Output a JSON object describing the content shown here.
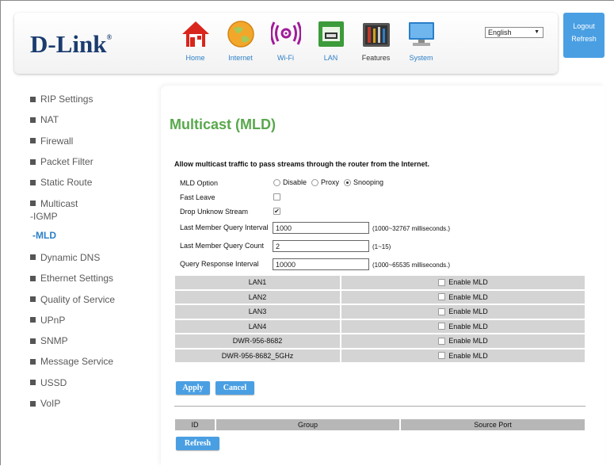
{
  "brand": {
    "logo_text": "D-Link",
    "logo_mark": "®"
  },
  "nav": [
    {
      "label": "Home",
      "icon": "home-icon"
    },
    {
      "label": "Internet",
      "icon": "globe-icon"
    },
    {
      "label": "Wi-Fi",
      "icon": "wifi-icon"
    },
    {
      "label": "LAN",
      "icon": "lan-icon"
    },
    {
      "label": "Features",
      "icon": "toolbox-icon"
    },
    {
      "label": "System",
      "icon": "monitor-icon"
    }
  ],
  "language": {
    "selected": "English"
  },
  "top_right": {
    "logout": "Logout",
    "refresh": "Refresh"
  },
  "sidebar": {
    "items": [
      {
        "label": "RIP Settings"
      },
      {
        "label": "NAT"
      },
      {
        "label": "Firewall"
      },
      {
        "label": "Packet Filter"
      },
      {
        "label": "Static Route"
      },
      {
        "label": "Multicast"
      }
    ],
    "sub_items": [
      {
        "label": "-IGMP"
      },
      {
        "label": "-MLD"
      }
    ],
    "items_after": [
      {
        "label": "Dynamic DNS"
      },
      {
        "label": "Ethernet Settings"
      },
      {
        "label": "Quality of Service"
      },
      {
        "label": "UPnP"
      },
      {
        "label": "SNMP"
      },
      {
        "label": "Message Service"
      },
      {
        "label": "USSD"
      },
      {
        "label": "VoIP"
      }
    ]
  },
  "main": {
    "title": "Multicast (MLD)",
    "description": "Allow multicast traffic to pass streams through the router from the Internet.",
    "mld_option": {
      "label": "MLD Option",
      "options": [
        "Disable",
        "Proxy",
        "Snooping"
      ],
      "selected": "Snooping"
    },
    "fast_leave": {
      "label": "Fast Leave",
      "checked": false
    },
    "drop_unknown": {
      "label": "Drop Unknow Stream",
      "checked": true
    },
    "lmqi": {
      "label": "Last Member Query Interval",
      "value": "1000",
      "hint": "(1000~32767 milliseconds.)"
    },
    "lmqc": {
      "label": "Last Member Query Count",
      "value": "2",
      "hint": "(1~15)"
    },
    "qri": {
      "label": "Query Response Interval",
      "value": "10000",
      "hint": "(1000~65535 milliseconds.)"
    },
    "lan_rows": [
      {
        "name": "LAN1",
        "enable_label": "Enable MLD"
      },
      {
        "name": "LAN2",
        "enable_label": "Enable MLD"
      },
      {
        "name": "LAN3",
        "enable_label": "Enable MLD"
      },
      {
        "name": "LAN4",
        "enable_label": "Enable MLD"
      },
      {
        "name": "DWR-956-8682",
        "enable_label": "Enable MLD"
      },
      {
        "name": "DWR-956-8682_5GHz",
        "enable_label": "Enable MLD"
      }
    ],
    "apply_label": "Apply",
    "cancel_label": "Cancel",
    "group_table": {
      "headers": [
        "ID",
        "Group",
        "Source Port"
      ]
    },
    "refresh_label": "Refresh"
  },
  "colors": {
    "accent": "#4a9fe3",
    "title": "#58a84c",
    "brand": "#1b3c6f"
  }
}
